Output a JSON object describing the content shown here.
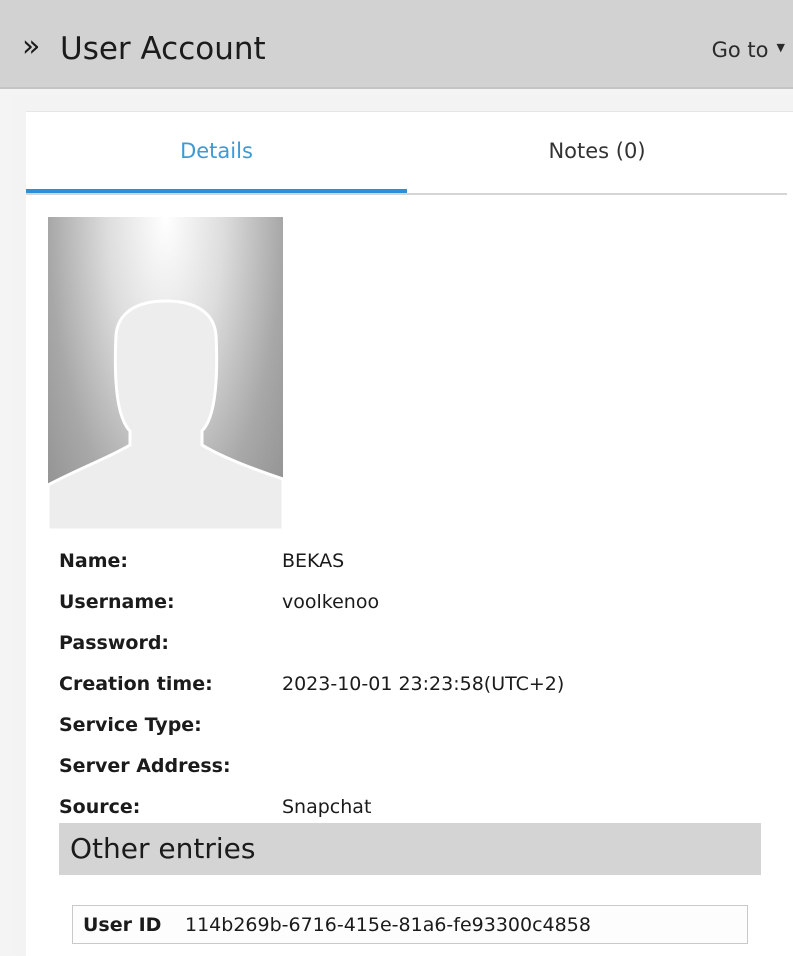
{
  "header": {
    "title": "User Account",
    "goto_label": "Go to"
  },
  "tabs": [
    {
      "label": "Details",
      "active": true
    },
    {
      "label": "Notes (0)",
      "active": false
    }
  ],
  "fields": [
    {
      "label": "Name:",
      "value": "BEKAS"
    },
    {
      "label": "Username:",
      "value": "voolkenoo"
    },
    {
      "label": "Password:",
      "value": ""
    },
    {
      "label": "Creation time:",
      "value": "2023-10-01 23:23:58(UTC+2)"
    },
    {
      "label": "Service Type:",
      "value": ""
    },
    {
      "label": "Server Address:",
      "value": ""
    },
    {
      "label": "Source:",
      "value": "Snapchat"
    }
  ],
  "other_entries": {
    "title": "Other entries",
    "items": [
      {
        "key": "User ID",
        "value": "114b269b-6716-415e-81a6-fe93300c4858"
      }
    ]
  },
  "colors": {
    "accent": "#2f8fd6",
    "header_bg": "#d2d2d2"
  }
}
